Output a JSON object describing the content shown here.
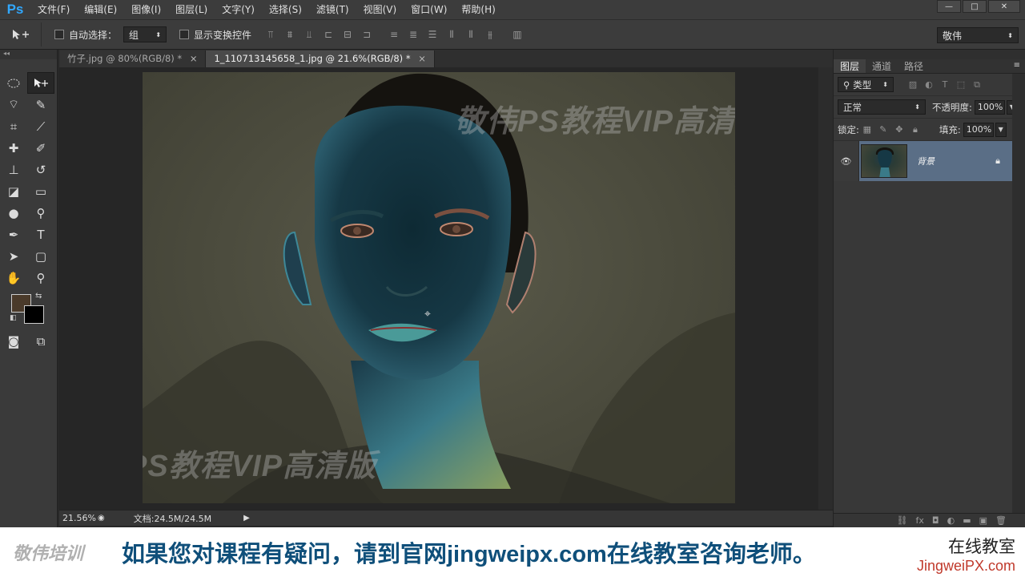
{
  "app": {
    "logo": "Ps"
  },
  "menu": [
    "文件(F)",
    "编辑(E)",
    "图像(I)",
    "图层(L)",
    "文字(Y)",
    "选择(S)",
    "滤镜(T)",
    "视图(V)",
    "窗口(W)",
    "帮助(H)"
  ],
  "window_controls": {
    "minimize": "—",
    "restore": "□",
    "close": "✕"
  },
  "options": {
    "auto_select_label": "自动选择：",
    "auto_select_value": "组",
    "transform_label": "显示变换控件",
    "workspace": "敬伟"
  },
  "tabs": [
    {
      "title": "竹子.jpg @ 80%(RGB/8) *",
      "close": "×"
    },
    {
      "title": "1_110713145658_1.jpg @ 21.6%(RGB/8) *",
      "close": "×"
    }
  ],
  "status": {
    "zoom": "21.56%",
    "doc": "文档:24.5M/24.5M"
  },
  "watermark": "敬伟PS教程VIP高清版",
  "panel": {
    "tabs": [
      "图层",
      "通道",
      "路径"
    ],
    "filter_label": "类型",
    "blend_mode": "正常",
    "opacity_label": "不透明度:",
    "opacity": "100%",
    "lock_label": "锁定:",
    "fill_label": "填充:",
    "fill": "100%",
    "layers": [
      {
        "name": "背景",
        "locked": true,
        "visible": true
      }
    ]
  },
  "colors": {
    "foreground": "#4a3a2a",
    "background": "#000000",
    "layer_selected": "#5a6e86"
  },
  "banner": {
    "logo": "敬伟培训",
    "text": "如果您对课程有疑问，请到官网jingweipx.com在线教室咨询老师。",
    "right_top": "在线教室",
    "right_bottom": "JingweiPX.com"
  }
}
